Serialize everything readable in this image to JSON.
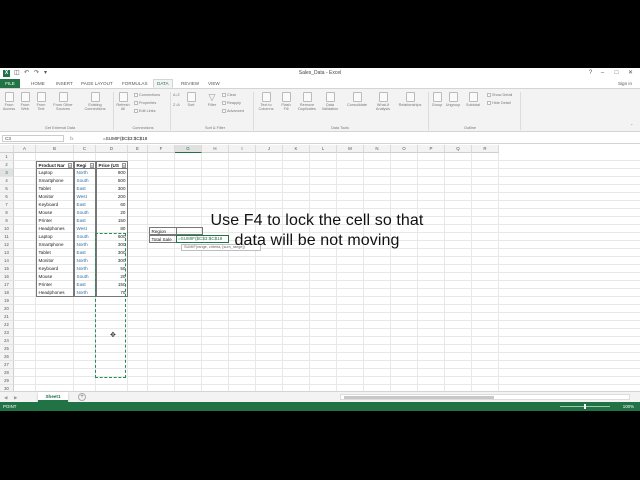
{
  "titlebar": {
    "title": "Sales_Data - Excel",
    "undo_icon": "undo-icon",
    "redo_icon": "redo-icon",
    "save_icon": "save-icon"
  },
  "tabs": [
    {
      "label": "FILE"
    },
    {
      "label": "HOME"
    },
    {
      "label": "INSERT"
    },
    {
      "label": "PAGE LAYOUT"
    },
    {
      "label": "FORMULAS"
    },
    {
      "label": "DATA"
    },
    {
      "label": "REVIEW"
    },
    {
      "label": "VIEW"
    }
  ],
  "signin": "Sign in",
  "ribbon": {
    "get_external": {
      "buttons": [
        "From Access",
        "From Web",
        "From Text",
        "From Other Sources",
        "Existing Connections"
      ],
      "label": "Get External Data"
    },
    "connections": {
      "refresh": "Refresh All",
      "small": [
        "Connections",
        "Properties",
        "Edit Links"
      ],
      "label": "Connections"
    },
    "sort_filter": {
      "sort_az": "A↓Z",
      "sort_za": "Z↓A",
      "sort": "Sort",
      "filter": "Filter",
      "small": [
        "Clear",
        "Reapply",
        "Advanced"
      ],
      "label": "Sort & Filter"
    },
    "data_tools": {
      "buttons": [
        "Text to Columns",
        "Flash Fill",
        "Remove Duplicates",
        "Data Validation",
        "Consolidate",
        "What-If Analysis",
        "Relationships"
      ],
      "label": "Data Tools"
    },
    "outline": {
      "buttons": [
        "Group",
        "Ungroup",
        "Subtotal"
      ],
      "small": [
        "Show Detail",
        "Hide Detail"
      ],
      "label": "Outline"
    }
  },
  "formula_bar": {
    "name_box": "C3",
    "fx": "fx",
    "formula": "=SUMIF($C$3:$C$18"
  },
  "columns": [
    "A",
    "B",
    "C",
    "D",
    "E",
    "F",
    "G",
    "H",
    "I",
    "J",
    "K",
    "L",
    "M",
    "N",
    "O",
    "P",
    "Q",
    "R"
  ],
  "rows": [
    "1",
    "2",
    "3",
    "4",
    "5",
    "6",
    "7",
    "8",
    "9",
    "10",
    "11",
    "12",
    "13",
    "14",
    "15",
    "16",
    "17",
    "18",
    "19",
    "20",
    "21",
    "22",
    "23",
    "24",
    "25",
    "26",
    "27",
    "28",
    "29",
    "30",
    "31",
    "32",
    "33",
    "34",
    "35",
    "36",
    "37"
  ],
  "table": {
    "headers": [
      "Product Nar",
      "Regi",
      "Price (US"
    ],
    "rows": [
      {
        "product": "Laptop",
        "region": "North",
        "price": "800"
      },
      {
        "product": "Smartphone",
        "region": "South",
        "price": "500"
      },
      {
        "product": "Tablet",
        "region": "East",
        "price": "300"
      },
      {
        "product": "Monitor",
        "region": "West",
        "price": "200"
      },
      {
        "product": "Keyboard",
        "region": "East",
        "price": "60"
      },
      {
        "product": "Mouse",
        "region": "South",
        "price": "20"
      },
      {
        "product": "Printer",
        "region": "East",
        "price": "150"
      },
      {
        "product": "Headphones",
        "region": "West",
        "price": "80"
      },
      {
        "product": "Laptop",
        "region": "South",
        "price": "600"
      },
      {
        "product": "Smartphone",
        "region": "North",
        "price": "300"
      },
      {
        "product": "Tablet",
        "region": "East",
        "price": "300"
      },
      {
        "product": "Monitor",
        "region": "North",
        "price": "300"
      },
      {
        "product": "Keyboard",
        "region": "North",
        "price": "50"
      },
      {
        "product": "Mouse",
        "region": "South",
        "price": "20"
      },
      {
        "product": "Printer",
        "region": "East",
        "price": "150"
      },
      {
        "product": "Headphones",
        "region": "North",
        "price": "70"
      }
    ]
  },
  "side": {
    "region_label": "Region",
    "total_label": "Total Sale",
    "formula_cell": "=SUMIF($C$3:$C$18",
    "tooltip": "SUMIF(range, criteria, [sum_range])"
  },
  "overlay": {
    "line1": "Use F4 to lock the cell so that",
    "line2": "data will be not moving"
  },
  "sheet_tab": "Sheet1",
  "status": {
    "mode": "POINT",
    "zoom": "100%"
  },
  "colors": {
    "accent": "#217346"
  }
}
